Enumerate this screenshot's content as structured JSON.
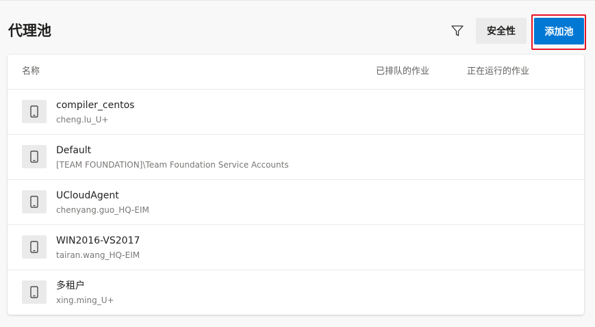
{
  "page": {
    "title": "代理池"
  },
  "toolbar": {
    "filter_icon": "filter-icon",
    "security_label": "安全性",
    "add_label": "添加池"
  },
  "table": {
    "columns": {
      "name": "名称",
      "queued": "已排队的作业",
      "running": "正在运行的作业"
    },
    "rows": [
      {
        "name": "compiler_centos",
        "owner": "cheng.lu_U+",
        "icon": "device-icon"
      },
      {
        "name": "Default",
        "owner": "[TEAM FOUNDATION]\\Team Foundation Service Accounts",
        "icon": "device-icon"
      },
      {
        "name": "UCloudAgent",
        "owner": "chenyang.guo_HQ-EIM",
        "icon": "device-icon"
      },
      {
        "name": "WIN2016-VS2017",
        "owner": "tairan.wang_HQ-EIM",
        "icon": "device-icon"
      },
      {
        "name": "多租户",
        "owner": "xing.ming_U+",
        "icon": "device-icon"
      }
    ]
  },
  "colors": {
    "primary": "#0078d4",
    "highlight": "#e81123",
    "secondary_button": "#ebebeb",
    "background": "#f8f8f8"
  }
}
